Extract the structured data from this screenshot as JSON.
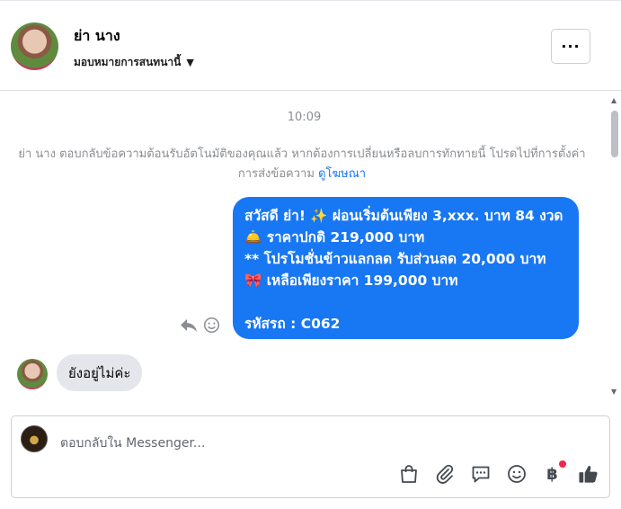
{
  "header": {
    "name": "ย่า นาง",
    "assign_label": "มอบหมายการสนทนานี้",
    "more_label": "···"
  },
  "thread": {
    "timestamp": "10:09",
    "notice_text": "ย่า นาง ตอบกลับข้อความต้อนรับอัตโนมัติของคุณแล้ว หากต้องการเปลี่ยนหรือลบการทักทายนี้ โปรดไปที่การตั้งค่าการส่งข้อความ",
    "notice_link": "ดูโฆษณา",
    "outgoing": {
      "lines": [
        "สวัสดี ย่า! ✨  ผ่อนเริ่มต้นเพียง 3,xxx. บาท 84 งวด",
        "🛎️ ราคาปกติ 219,000 บาท",
        "** โปรโมชั่นข้าวแลกลด รับส่วนลด 20,000 บาท",
        "🎀  เหลือเพียงราคา 199,000 บาท",
        "",
        " รหัสรถ : C062"
      ]
    },
    "incoming": {
      "text": "ยังอยู่ไม่ค่ะ"
    }
  },
  "composer": {
    "placeholder": "ตอบกลับใน Messenger..."
  },
  "colors": {
    "accent": "#1877f2",
    "incoming_bubble": "#e4e6eb",
    "badge": "#f02849"
  },
  "icons": [
    "reply-icon",
    "emoji-icon",
    "shopping-bag-icon",
    "attachment-icon",
    "saved-reply-icon",
    "emoji-icon",
    "baht-payment-icon",
    "thumbs-up-icon"
  ]
}
